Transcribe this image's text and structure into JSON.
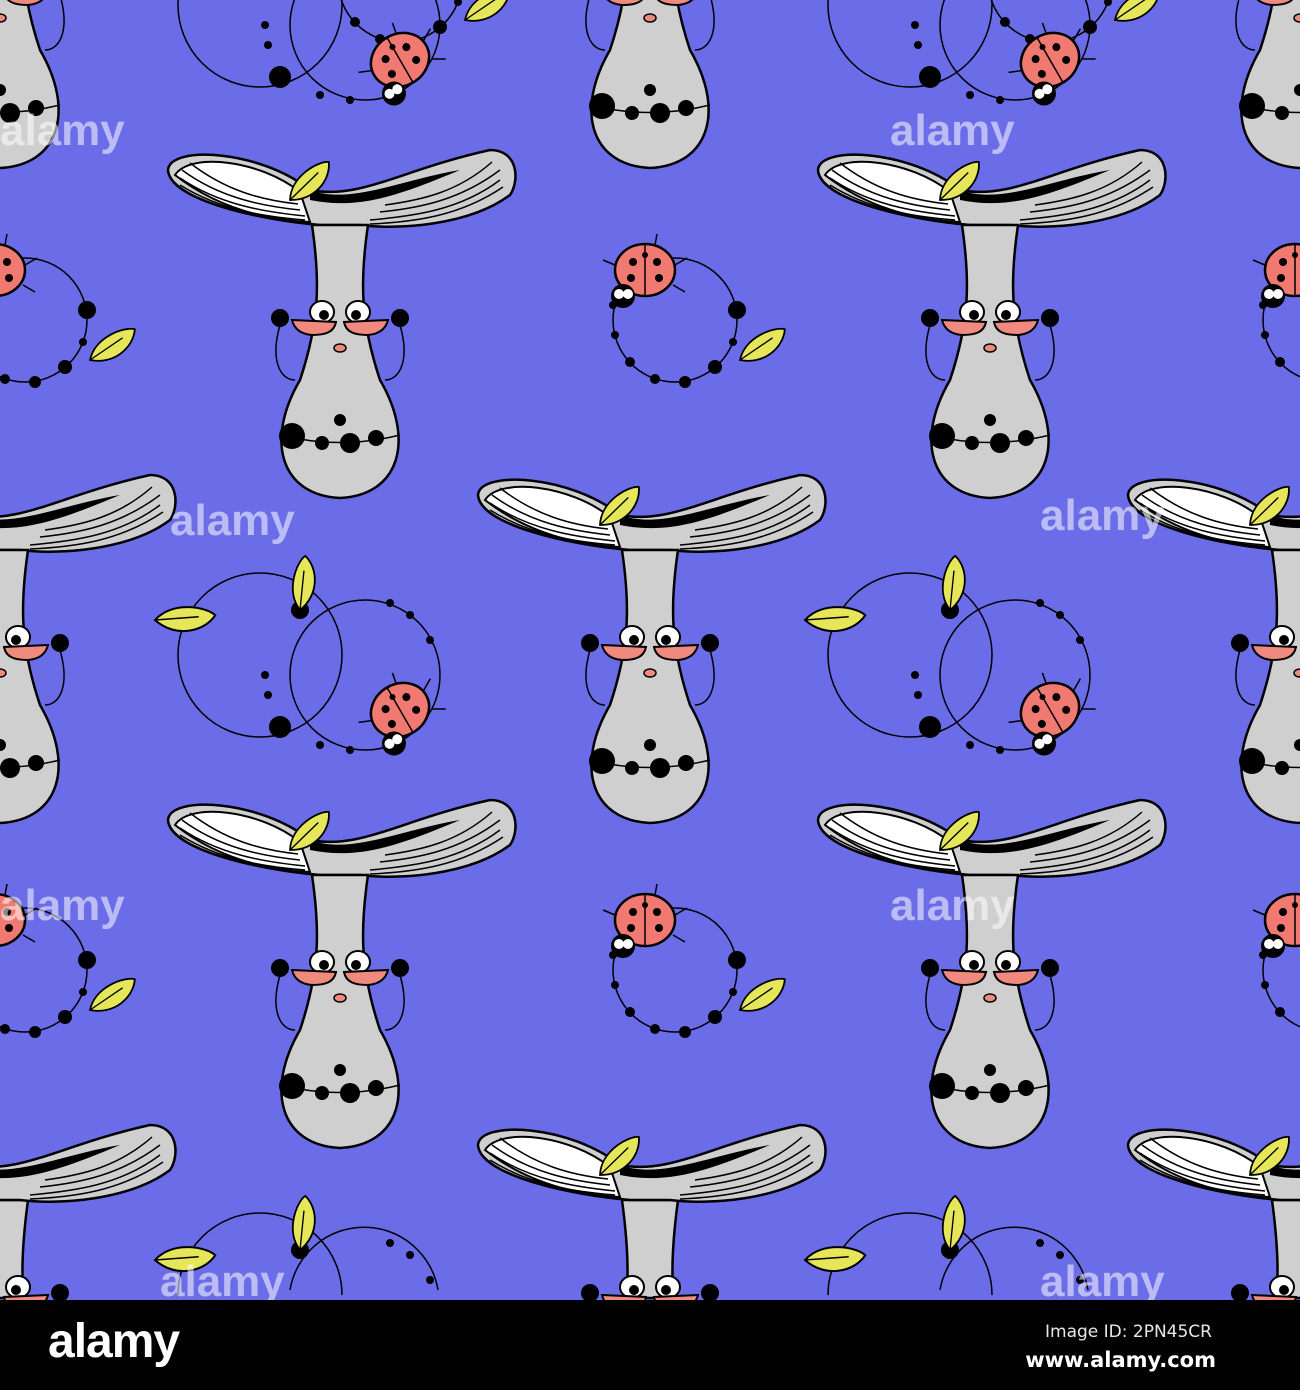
{
  "pattern": {
    "background": "#6b6ce8",
    "motifs": [
      "mushroom-lady-with-hat-and-glasses",
      "ladybug-on-bead-ring",
      "double-ring-with-leaves"
    ],
    "colors": {
      "mushroom": "#cfcfcf",
      "glasses": "#f08a7e",
      "leaf": "#e6e65a",
      "ladybug": "#f07a72",
      "outline": "#000000"
    }
  },
  "watermark": {
    "text": "alamy",
    "small": "a"
  },
  "footer": {
    "logo": "alamy",
    "image_id": "Image ID: 2PN45CR",
    "website": "www.alamy.com"
  }
}
